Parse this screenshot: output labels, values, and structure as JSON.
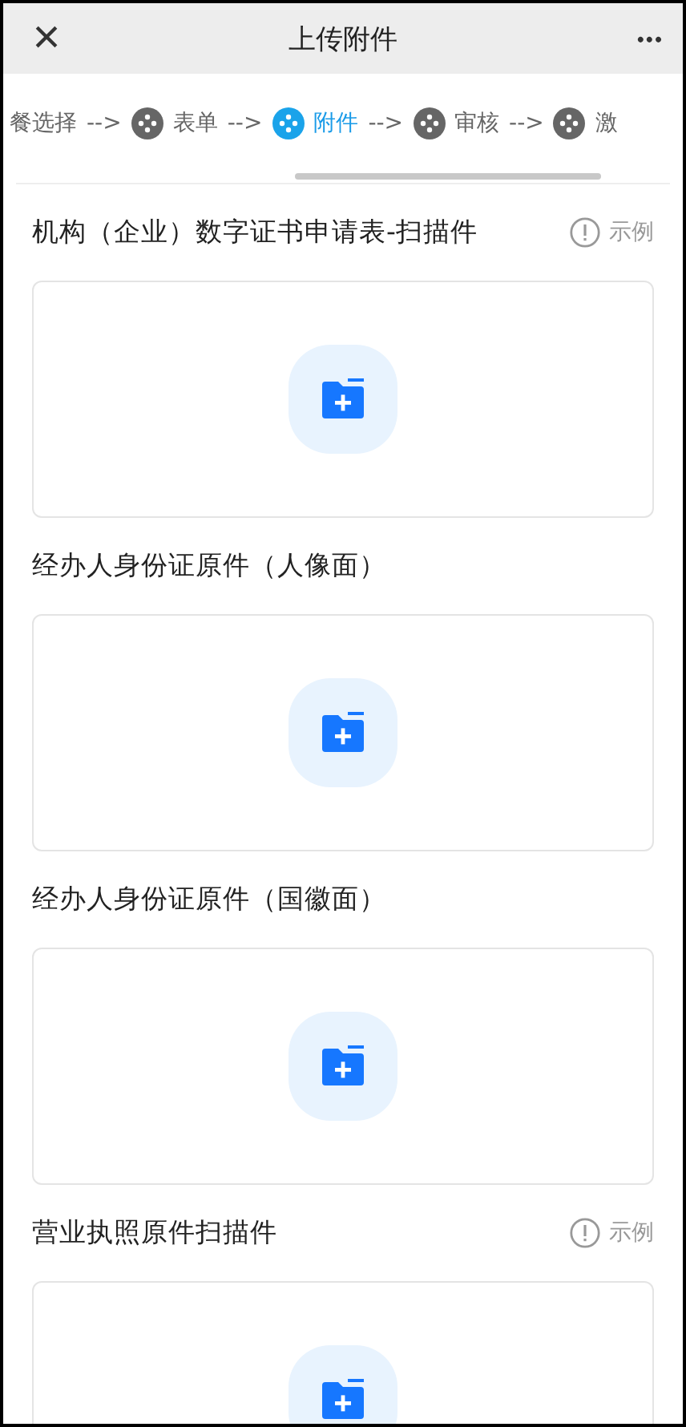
{
  "header": {
    "close": "×",
    "title": "上传附件",
    "more": "•••"
  },
  "steps": [
    {
      "kind": "label",
      "label": "餐选择",
      "selected": false
    },
    {
      "kind": "step",
      "connector": "-->",
      "label": "表单",
      "selected": false
    },
    {
      "kind": "step",
      "connector": "-->",
      "label": "附件",
      "selected": true
    },
    {
      "kind": "step",
      "connector": "-->",
      "label": "审核",
      "selected": false
    },
    {
      "kind": "step",
      "connector": "-->",
      "label": "激",
      "selected": false
    }
  ],
  "sections": [
    {
      "title": "机构（企业）数字证书申请表-扫描件",
      "example": "示例"
    },
    {
      "title": "经办人身份证原件（人像面）"
    },
    {
      "title": "经办人身份证原件（国徽面）"
    },
    {
      "title": "营业执照原件扫描件",
      "example": "示例"
    }
  ]
}
